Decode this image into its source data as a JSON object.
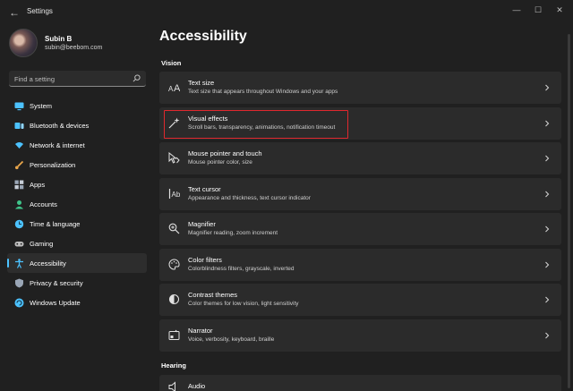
{
  "window": {
    "title": "Settings",
    "back": "←",
    "min": "—",
    "max": "☐",
    "close": "✕"
  },
  "profile": {
    "name": "Subin B",
    "email": "subin@beebom.com"
  },
  "search": {
    "placeholder": "Find a setting"
  },
  "nav": [
    {
      "label": "System",
      "icon": "monitor-icon",
      "color": "#4cc2ff"
    },
    {
      "label": "Bluetooth & devices",
      "icon": "bluetooth-icon",
      "color": "#4cc2ff"
    },
    {
      "label": "Network & internet",
      "icon": "wifi-icon",
      "color": "#4cc2ff"
    },
    {
      "label": "Personalization",
      "icon": "brush-icon",
      "color": "#e8a54b"
    },
    {
      "label": "Apps",
      "icon": "apps-icon",
      "color": "#9aa6b6"
    },
    {
      "label": "Accounts",
      "icon": "person-icon",
      "color": "#3fc48a"
    },
    {
      "label": "Time & language",
      "icon": "globe-clock-icon",
      "color": "#4cc2ff"
    },
    {
      "label": "Gaming",
      "icon": "gamepad-icon",
      "color": "#bdbdbd"
    },
    {
      "label": "Accessibility",
      "icon": "accessibility-icon",
      "color": "#4cc2ff",
      "active": true
    },
    {
      "label": "Privacy & security",
      "icon": "shield-icon",
      "color": "#9aa6b6"
    },
    {
      "label": "Windows Update",
      "icon": "update-icon",
      "color": "#4cc2ff"
    }
  ],
  "main": {
    "title": "Accessibility",
    "sections": [
      {
        "title": "Vision"
      },
      {
        "title": "Hearing"
      }
    ],
    "cards": [
      {
        "title": "Text size",
        "desc": "Text size that appears throughout Windows and your apps",
        "icon": "text-size-icon"
      },
      {
        "title": "Visual effects",
        "desc": "Scroll bars, transparency, animations, notification timeout",
        "icon": "sparkle-icon"
      },
      {
        "title": "Mouse pointer and touch",
        "desc": "Mouse pointer color, size",
        "icon": "pointer-icon"
      },
      {
        "title": "Text cursor",
        "desc": "Appearance and thickness, text cursor indicator",
        "icon": "text-cursor-icon"
      },
      {
        "title": "Magnifier",
        "desc": "Magnifier reading, zoom increment",
        "icon": "magnifier-icon"
      },
      {
        "title": "Color filters",
        "desc": "Colorblindness filters, grayscale, inverted",
        "icon": "palette-icon"
      },
      {
        "title": "Contrast themes",
        "desc": "Color themes for low vision, light sensitivity",
        "icon": "contrast-icon"
      },
      {
        "title": "Narrator",
        "desc": "Voice, verbosity, keyboard, braille",
        "icon": "narrator-icon"
      },
      {
        "title": "Audio",
        "desc": "",
        "icon": "audio-icon"
      }
    ]
  },
  "colors": {
    "accent": "#4cc2ff",
    "highlight": "#e0282e",
    "card": "#2b2b2b",
    "bg": "#202020"
  }
}
